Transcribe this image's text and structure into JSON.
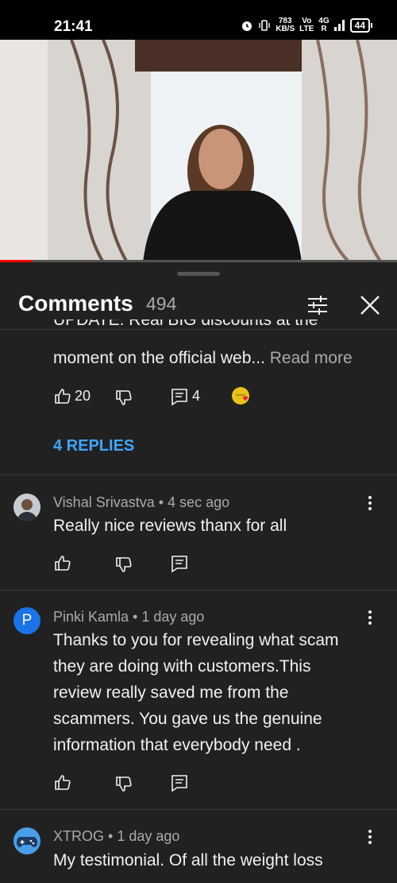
{
  "status": {
    "time": "21:41",
    "speed_value": "783",
    "speed_unit": "KB/S",
    "network1": "Vo",
    "network1b": "LTE",
    "network2": "4G",
    "network2b": "R",
    "battery": "44"
  },
  "comments_header": {
    "title": "Comments",
    "count": "494"
  },
  "progress": 0.08,
  "pinned": {
    "text_top": "UPDATE: Real BIG discounts at the",
    "text_bottom": "moment on the official web...",
    "read_more": "Read more",
    "likes": "20",
    "reply_count": "4",
    "replies_link": "4 REPLIES"
  },
  "comments": [
    {
      "author": "Vishal Srivastva",
      "time": "4 sec ago",
      "text": "Really nice reviews thanx for all"
    },
    {
      "author": "Pinki Kamla",
      "avatar_letter": "P",
      "time": "1 day ago",
      "lines": [
        "Thanks to you for revealing what scam",
        "they are doing with customers.This",
        "review really saved me from the",
        "scammers. You gave us the genuine",
        "information that everybody need ."
      ]
    },
    {
      "author": "XTROG",
      "time": "1 day ago",
      "text": "My testimonial. Of all the weight loss"
    }
  ],
  "colors": {
    "accent_blue": "#3ea6ff",
    "avatar_blue": "#1a73e8",
    "progress_red": "#ff0000"
  }
}
